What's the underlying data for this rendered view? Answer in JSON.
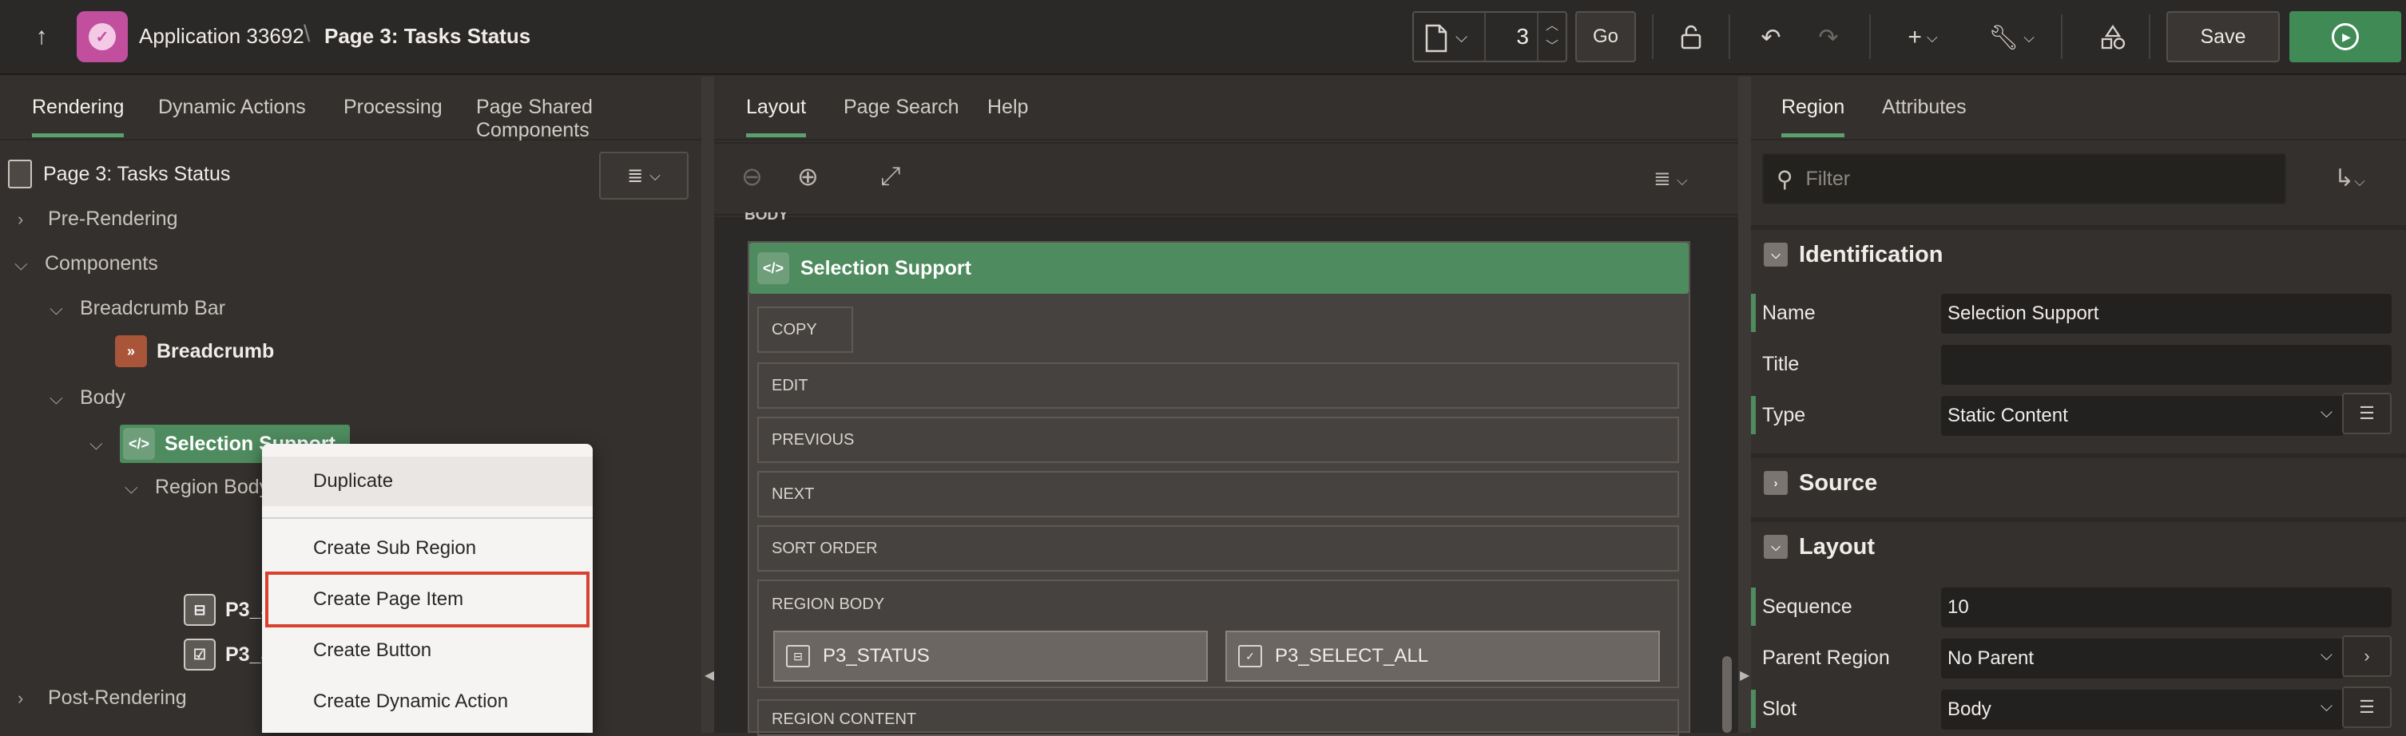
{
  "header": {
    "app_name": "Application 33692",
    "separator": "\\",
    "page_name": "Page 3: Tasks Status",
    "page_number": "3",
    "go_label": "Go",
    "save_label": "Save"
  },
  "left_panel": {
    "tabs": [
      "Rendering",
      "Dynamic Actions",
      "Processing",
      "Page Shared Components"
    ],
    "active_tab": "Rendering",
    "tree_title": "Page 3: Tasks Status",
    "tree": {
      "pre_rendering": "Pre-Rendering",
      "components": "Components",
      "breadcrumb_bar": "Breadcrumb Bar",
      "breadcrumb": "Breadcrumb",
      "body": "Body",
      "selection_support": "Selection Support",
      "region_body": "Region Body",
      "item1": "P3_S",
      "item2": "P3_S",
      "post_rendering": "Post-Rendering"
    }
  },
  "context_menu": {
    "items": [
      "Duplicate",
      "Create Sub Region",
      "Create Page Item",
      "Create Button",
      "Create Dynamic Action"
    ],
    "highlighted": "Create Page Item"
  },
  "center_panel": {
    "tabs": [
      "Layout",
      "Page Search",
      "Help"
    ],
    "active_tab": "Layout",
    "body_label": "BODY",
    "region_title": "Selection Support",
    "slots": [
      "COPY",
      "EDIT",
      "PREVIOUS",
      "NEXT",
      "SORT ORDER",
      "REGION BODY",
      "REGION CONTENT"
    ],
    "items": [
      "P3_STATUS",
      "P3_SELECT_ALL"
    ]
  },
  "right_panel": {
    "tabs": [
      "Region",
      "Attributes"
    ],
    "active_tab": "Region",
    "filter_placeholder": "Filter",
    "sections": {
      "identification": "Identification",
      "source": "Source",
      "layout": "Layout"
    },
    "properties": {
      "name_label": "Name",
      "name_value": "Selection Support",
      "title_label": "Title",
      "title_value": "",
      "type_label": "Type",
      "type_value": "Static Content",
      "sequence_label": "Sequence",
      "sequence_value": "10",
      "parent_label": "Parent Region",
      "parent_value": "No Parent",
      "slot_label": "Slot",
      "slot_value": "Body"
    }
  },
  "colors": {
    "accent_green": "#4e8b5e",
    "highlight_red": "#d8412f",
    "app_pink": "#c24f9d"
  }
}
